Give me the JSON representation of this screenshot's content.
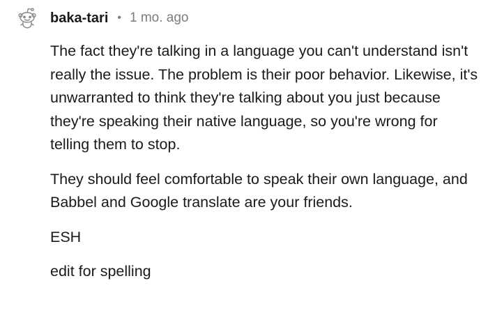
{
  "comment": {
    "author": "baka-tari",
    "separator": "•",
    "timestamp": "1 mo. ago",
    "avatar_icon": "snoo-avatar-icon",
    "paragraphs": [
      "The fact they're talking in a language you can't understand isn't really the issue. The problem is their poor behavior. Likewise, it's unwarranted to think they're talking about you just because they're speaking their native language, so you're wrong for telling them to stop.",
      "They should feel comfortable to speak their own language, and Babbel and Google translate are your friends.",
      "ESH",
      "edit for spelling"
    ]
  }
}
